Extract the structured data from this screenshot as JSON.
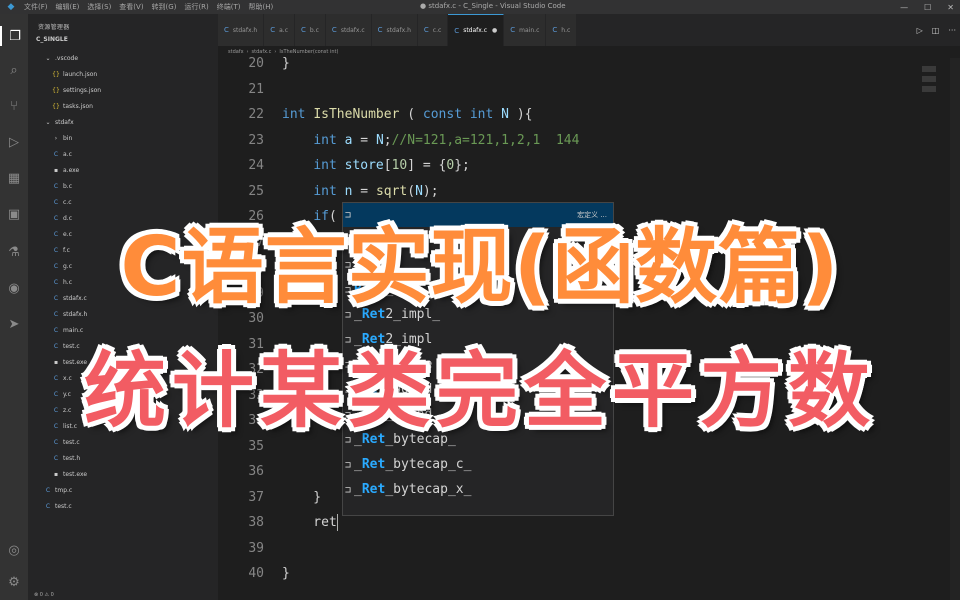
{
  "titlebar": {
    "menu": [
      "文件(F)",
      "编辑(E)",
      "选择(S)",
      "查看(V)",
      "转到(G)",
      "运行(R)",
      "终端(T)",
      "帮助(H)"
    ],
    "window_title": "● stdafx.c - C_Single - Visual Studio Code"
  },
  "sidebar": {
    "title": "资源管理器",
    "root": "C_SINGLE",
    "items": [
      {
        "label": ".vscode",
        "icon": "chevron-down",
        "indent": 1
      },
      {
        "label": "launch.json",
        "icon": "json",
        "indent": 2
      },
      {
        "label": "settings.json",
        "icon": "json",
        "indent": 2
      },
      {
        "label": "tasks.json",
        "icon": "json",
        "indent": 2
      },
      {
        "label": "stdafx",
        "icon": "chevron-down",
        "indent": 1
      },
      {
        "label": "bin",
        "icon": "chevron-right",
        "indent": 2
      },
      {
        "label": "a.c",
        "icon": "c",
        "indent": 2
      },
      {
        "label": "a.exe",
        "icon": "file",
        "indent": 2
      },
      {
        "label": "b.c",
        "icon": "c",
        "indent": 2
      },
      {
        "label": "c.c",
        "icon": "c",
        "indent": 2
      },
      {
        "label": "d.c",
        "icon": "c",
        "indent": 2
      },
      {
        "label": "e.c",
        "icon": "c",
        "indent": 2
      },
      {
        "label": "f.c",
        "icon": "c",
        "indent": 2
      },
      {
        "label": "g.c",
        "icon": "c",
        "indent": 2
      },
      {
        "label": "h.c",
        "icon": "c",
        "indent": 2
      },
      {
        "label": "stdafx.c",
        "icon": "c",
        "indent": 2
      },
      {
        "label": "stdafx.h",
        "icon": "c",
        "indent": 2
      },
      {
        "label": "main.c",
        "icon": "c",
        "indent": 2
      },
      {
        "label": "test.c",
        "icon": "c",
        "indent": 2
      },
      {
        "label": "test.exe",
        "icon": "file",
        "indent": 2
      },
      {
        "label": "x.c",
        "icon": "c",
        "indent": 2
      },
      {
        "label": "y.c",
        "icon": "c",
        "indent": 2
      },
      {
        "label": "z.c",
        "icon": "c",
        "indent": 2
      },
      {
        "label": "list.c",
        "icon": "c",
        "indent": 2
      },
      {
        "label": "test.c",
        "icon": "c",
        "indent": 2
      },
      {
        "label": "test.h",
        "icon": "c",
        "indent": 2
      },
      {
        "label": "test.exe",
        "icon": "file",
        "indent": 2
      },
      {
        "label": "tmp.c",
        "icon": "c",
        "indent": 1
      },
      {
        "label": "test.c",
        "icon": "c",
        "indent": 1
      }
    ]
  },
  "tabs": [
    {
      "label": "stdafx.h",
      "active": false
    },
    {
      "label": "a.c",
      "active": false
    },
    {
      "label": "b.c",
      "active": false
    },
    {
      "label": "stdafx.c",
      "active": false
    },
    {
      "label": "stdafx.h",
      "active": false
    },
    {
      "label": "c.c",
      "active": false
    },
    {
      "label": "stdafx.c",
      "active": true
    },
    {
      "label": "main.c",
      "active": false
    },
    {
      "label": "h.c",
      "active": false
    }
  ],
  "breadcrumb": [
    "stdafx",
    "stdafx.c",
    "IsTheNumber(const int)"
  ],
  "editor": {
    "lines": [
      {
        "n": "20",
        "tokens": [
          [
            "pu",
            "}"
          ]
        ]
      },
      {
        "n": "21",
        "tokens": []
      },
      {
        "n": "22",
        "tokens": [
          [
            "kw",
            "int"
          ],
          [
            "pu",
            " "
          ],
          [
            "fn",
            "IsTheNumber"
          ],
          [
            "pu",
            " ( "
          ],
          [
            "kw",
            "const"
          ],
          [
            "pu",
            " "
          ],
          [
            "kw",
            "int"
          ],
          [
            "pu",
            " "
          ],
          [
            "va",
            "N"
          ],
          [
            "pu",
            " ){"
          ]
        ]
      },
      {
        "n": "23",
        "tokens": [
          [
            "pu",
            "    "
          ],
          [
            "kw",
            "int"
          ],
          [
            "pu",
            " "
          ],
          [
            "va",
            "a"
          ],
          [
            "pu",
            " = "
          ],
          [
            "va",
            "N"
          ],
          [
            "pu",
            ";"
          ],
          [
            "cm",
            "//N=121,a=121,1,2,1  144"
          ]
        ]
      },
      {
        "n": "24",
        "tokens": [
          [
            "pu",
            "    "
          ],
          [
            "kw",
            "int"
          ],
          [
            "pu",
            " "
          ],
          [
            "va",
            "store"
          ],
          [
            "pu",
            "["
          ],
          [
            "nu",
            "10"
          ],
          [
            "pu",
            "] = {"
          ],
          [
            "nu",
            "0"
          ],
          [
            "pu",
            "};"
          ]
        ]
      },
      {
        "n": "25",
        "tokens": [
          [
            "pu",
            "    "
          ],
          [
            "kw",
            "int"
          ],
          [
            "pu",
            " "
          ],
          [
            "va",
            "n"
          ],
          [
            "pu",
            " = "
          ],
          [
            "fn",
            "sqrt"
          ],
          [
            "pu",
            "("
          ],
          [
            "va",
            "N"
          ],
          [
            "pu",
            ");"
          ]
        ]
      },
      {
        "n": "26",
        "tokens": [
          [
            "pu",
            "    "
          ],
          [
            "kw",
            "if"
          ],
          [
            "pu",
            "("
          ]
        ]
      },
      {
        "n": "27",
        "tokens": []
      },
      {
        "n": "28",
        "tokens": []
      },
      {
        "n": "29",
        "tokens": []
      },
      {
        "n": "30",
        "tokens": []
      },
      {
        "n": "31",
        "tokens": []
      },
      {
        "n": "32",
        "tokens": []
      },
      {
        "n": "33",
        "tokens": []
      },
      {
        "n": "34",
        "tokens": []
      },
      {
        "n": "35",
        "tokens": []
      },
      {
        "n": "36",
        "tokens": []
      },
      {
        "n": "37",
        "tokens": [
          [
            "pu",
            "    }"
          ]
        ]
      },
      {
        "n": "38",
        "tokens": [
          [
            "pu",
            "    ret"
          ]
        ]
      },
      {
        "n": "39",
        "tokens": []
      },
      {
        "n": "40",
        "tokens": [
          [
            "pu",
            "}"
          ]
        ]
      }
    ]
  },
  "suggest": {
    "items": [
      {
        "prefix": "",
        "match": "",
        "rest": "",
        "detail": "",
        "selected": true
      },
      {
        "prefix": "",
        "match": "",
        "rest": "",
        "detail": "",
        "selected": false
      },
      {
        "prefix": "",
        "match": "",
        "rest": "",
        "detail": "",
        "selected": false
      },
      {
        "prefix": "",
        "match": "Ret",
        "rest": "1_impl",
        "detail": "",
        "selected": false
      },
      {
        "prefix": "_",
        "match": "Ret",
        "rest": "2_impl_",
        "detail": "",
        "selected": false
      },
      {
        "prefix": "_",
        "match": "Ret",
        "rest": "2_impl",
        "detail": "",
        "selected": false
      },
      {
        "prefix": "_",
        "match": "Ret",
        "rest": "_range",
        "detail": "",
        "selected": false
      },
      {
        "prefix": "_",
        "match": "Ret",
        "rest": "_bound",
        "detail": "",
        "selected": false
      },
      {
        "prefix": "_",
        "match": "Ret",
        "rest": "_bound_",
        "detail": "",
        "selected": false
      },
      {
        "prefix": "_",
        "match": "Ret",
        "rest": "_bytecap_",
        "detail": "",
        "selected": false
      },
      {
        "prefix": "_",
        "match": "Ret",
        "rest": "_bytecap_c_",
        "detail": "",
        "selected": false
      },
      {
        "prefix": "_",
        "match": "Ret",
        "rest": "_bytecap_x_",
        "detail": "",
        "selected": false
      }
    ],
    "first_detail": "宏定义 ..."
  },
  "overlay": {
    "title_line1": "C语言实现(函数篇)",
    "title_line2": "统计某类完全平方数",
    "color1": "#ff8c3a",
    "color2": "#f25c63"
  },
  "statusbar": {
    "text": "⊗ 0 ⚠ 0"
  }
}
